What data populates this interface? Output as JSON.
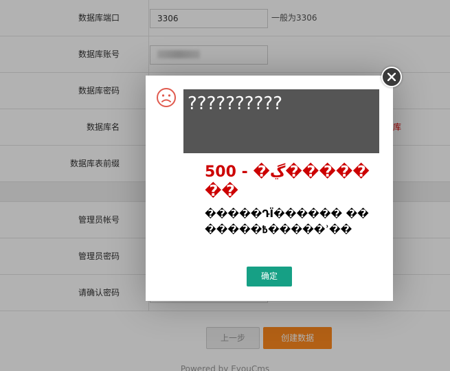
{
  "form": {
    "rows_top": [
      {
        "label": "数据库端口",
        "value": "3306",
        "hint": "一般为3306"
      },
      {
        "label": "数据库账号",
        "value": ""
      },
      {
        "label": "数据库密码"
      },
      {
        "label": "数据库名",
        "red_hint": "库"
      },
      {
        "label": "数据库表前缀"
      }
    ],
    "rows_bottom": [
      {
        "label": "管理员帐号"
      },
      {
        "label": "管理员密码"
      },
      {
        "label": "请确认密码"
      }
    ],
    "prev_button": "上一步",
    "create_button": "创建数据",
    "powered_by": "Powered by EyouCms"
  },
  "dialog": {
    "garbled_header": "??????????",
    "error_title": "500 - �ڲ�������",
    "error_body": "�����ԴΪ������ �������߿�����ʾ��",
    "ok_button": "确定"
  },
  "colors": {
    "ok_button": "#16a085",
    "create_button": "#ff8a1f",
    "error_title": "#cc0000",
    "sad_face": "#e05a4e"
  }
}
